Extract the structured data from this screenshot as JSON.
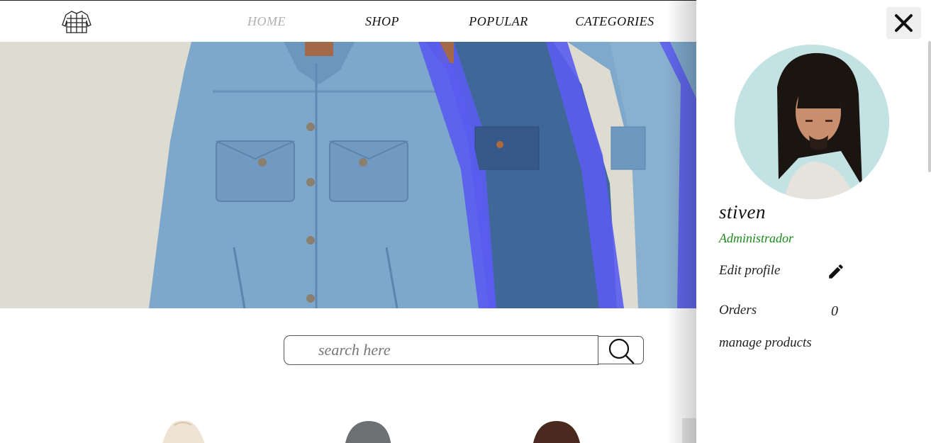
{
  "nav": {
    "logo_icon": "jacket-logo-icon",
    "items": [
      {
        "label": "HOME",
        "active": true
      },
      {
        "label": "SHOP",
        "active": false
      },
      {
        "label": "POPULAR",
        "active": false
      },
      {
        "label": "CATEGORIES",
        "active": false
      }
    ]
  },
  "search": {
    "placeholder": "search here",
    "button_icon": "search-icon"
  },
  "profile_panel": {
    "close_icon": "close-icon",
    "name": "stiven",
    "role": "Administrador",
    "edit_profile_label": "Edit profile",
    "edit_icon": "pencil-icon",
    "orders_label": "Orders",
    "orders_count": "0",
    "manage_products_label": "manage products"
  },
  "colors": {
    "role_green": "#1a8a1a",
    "nav_active": "#b0b0b0",
    "hero_bg": "#dedbd1",
    "denim": "#6f9ac6",
    "accent_blue": "#5a5cf0"
  }
}
